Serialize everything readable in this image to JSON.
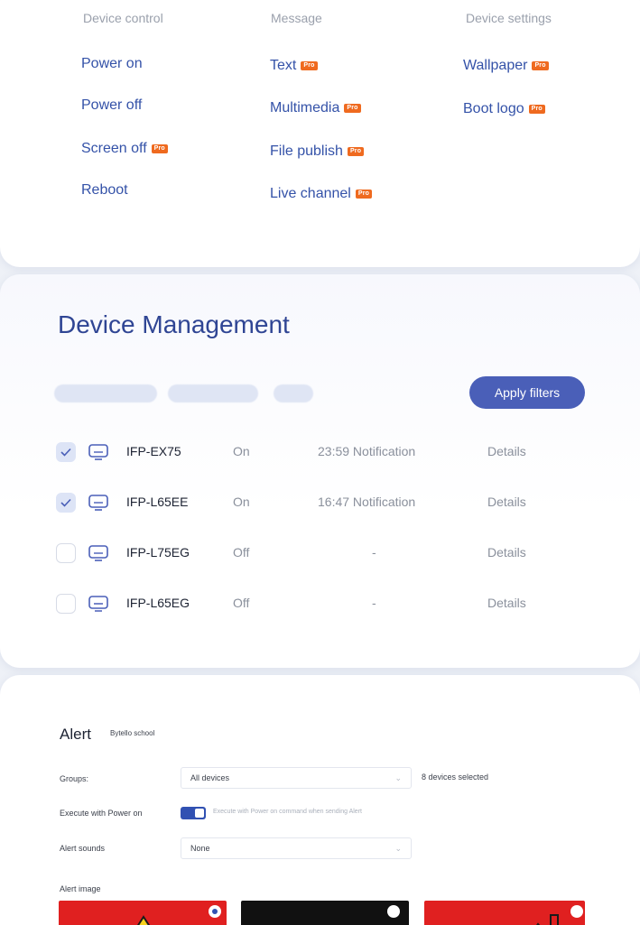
{
  "device_panel": {
    "columns": [
      {
        "title": "Device control"
      },
      {
        "title": "Message"
      },
      {
        "title": "Device settings"
      }
    ],
    "pro_badge": "Pro",
    "device_control": [
      "Power on",
      "Power off",
      "Screen off",
      "Reboot"
    ],
    "message": [
      "Text",
      "Multimedia",
      "File publish",
      "Live channel"
    ],
    "device_settings": [
      "Wallpaper",
      "Boot logo"
    ]
  },
  "device_management": {
    "title": "Device Management",
    "apply_filters_label": "Apply filters",
    "devices": [
      {
        "name": "IFP-EX75",
        "state": "On",
        "notice": "23:59 Notification",
        "details": "Details",
        "checked": true
      },
      {
        "name": "IFP-L65EE",
        "state": "On",
        "notice": "16:47 Notification",
        "details": "Details",
        "checked": true
      },
      {
        "name": "IFP-L75EG",
        "state": "Off",
        "notice": "-",
        "details": "Details",
        "checked": false
      },
      {
        "name": "IFP-L65EG",
        "state": "Off",
        "notice": "-",
        "details": "Details",
        "checked": false
      }
    ]
  },
  "alert": {
    "title": "Alert",
    "school": "Bytello school",
    "groups_label": "Groups:",
    "groups_value": "All devices",
    "devices_selected": "8 devices selected",
    "execute_label": "Execute with Power on",
    "execute_toggle_on": true,
    "execute_desc": "Execute with Power on command when sending Alert",
    "sounds_label": "Alert sounds",
    "sounds_value": "None",
    "image_label": "Alert image"
  },
  "colors": {
    "accent": "#3452a8",
    "title_blue": "#2f4594",
    "button_blue": "#4a5fb8",
    "pro_orange": "#ef6a1f",
    "alert_red": "#e02020",
    "alert_black": "#111111"
  }
}
